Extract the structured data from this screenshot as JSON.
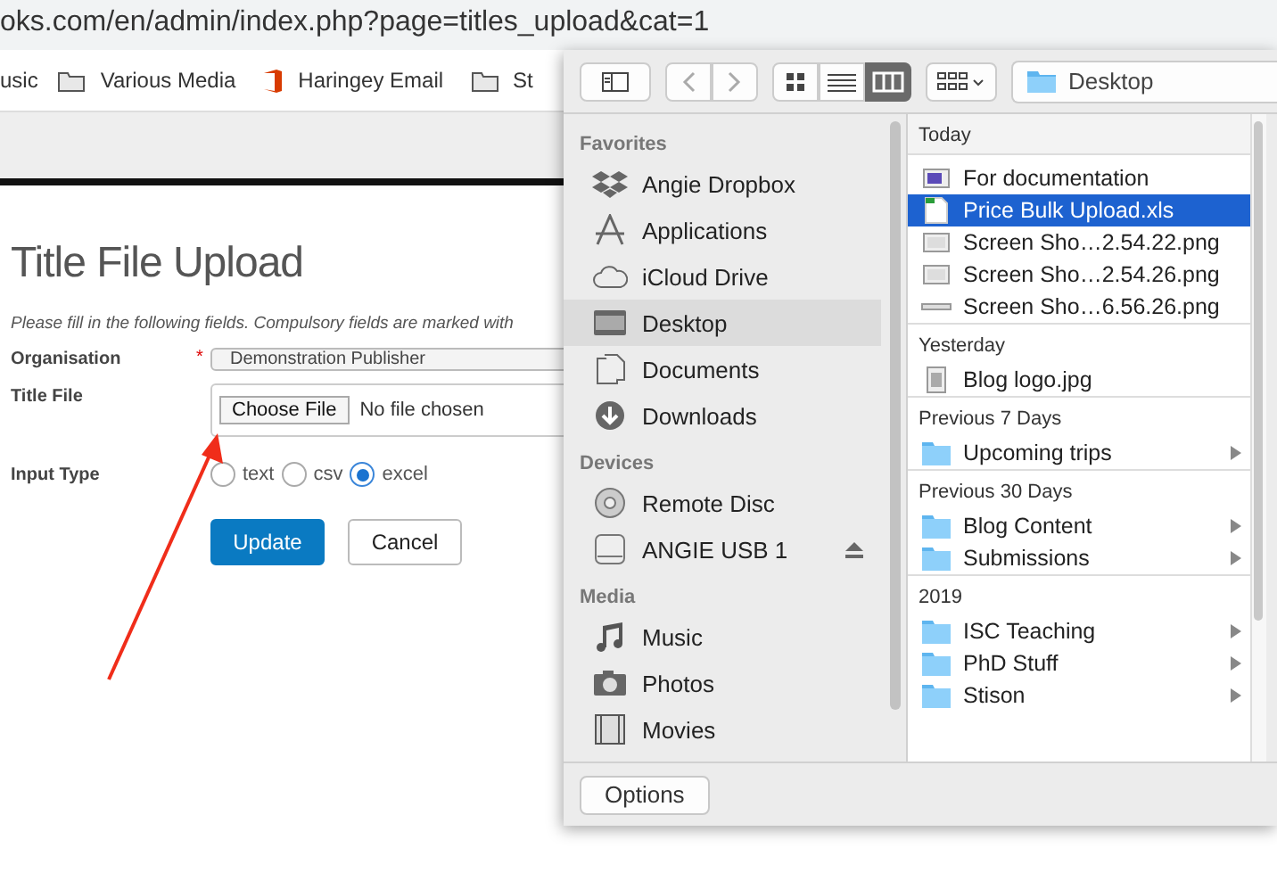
{
  "address_bar": {
    "url": "oks.com/en/admin/index.php?page=titles_upload&cat=1"
  },
  "bookmarks": [
    {
      "label": "usic",
      "kind": "text"
    },
    {
      "label": "Various Media",
      "kind": "folder"
    },
    {
      "label": "Haringey Email",
      "kind": "office"
    },
    {
      "label": "St",
      "kind": "folder"
    }
  ],
  "page": {
    "title": "Title File Upload",
    "instructions": "Please fill in the following fields. Compulsory fields are marked with",
    "organisation": {
      "label": "Organisation",
      "required": true,
      "required_mark": "*",
      "value": "Demonstration Publisher"
    },
    "title_file": {
      "label": "Title File",
      "button": "Choose File",
      "status": "No file chosen"
    },
    "input_type": {
      "label": "Input Type",
      "options": [
        {
          "label": "text",
          "selected": false
        },
        {
          "label": "csv",
          "selected": false
        },
        {
          "label": "excel",
          "selected": true
        }
      ]
    },
    "buttons": [
      {
        "label": "Update",
        "kind": "primary"
      },
      {
        "label": "Cancel",
        "kind": "default"
      }
    ]
  },
  "dialog": {
    "view_modes": [
      {
        "kind": "icons",
        "selected": false
      },
      {
        "kind": "list",
        "selected": false
      },
      {
        "kind": "columns",
        "selected": true
      }
    ],
    "location": "Desktop",
    "sidebar": [
      {
        "heading": "Favorites",
        "items": [
          {
            "label": "Angie Dropbox",
            "kind": "dropbox",
            "selected": false
          },
          {
            "label": "Applications",
            "kind": "apps",
            "selected": false
          },
          {
            "label": "iCloud Drive",
            "kind": "cloud",
            "selected": false
          },
          {
            "label": "Desktop",
            "kind": "desktop",
            "selected": true
          },
          {
            "label": "Documents",
            "kind": "docs",
            "selected": false
          },
          {
            "label": "Downloads",
            "kind": "download",
            "selected": false
          }
        ]
      },
      {
        "heading": "Devices",
        "items": [
          {
            "label": "Remote Disc",
            "kind": "disc",
            "selected": false
          },
          {
            "label": "ANGIE USB 1",
            "kind": "drive",
            "selected": false,
            "eject": true
          }
        ]
      },
      {
        "heading": "Media",
        "items": [
          {
            "label": "Music",
            "kind": "music",
            "selected": false
          },
          {
            "label": "Photos",
            "kind": "camera",
            "selected": false
          },
          {
            "label": "Movies",
            "kind": "film",
            "selected": false
          }
        ]
      }
    ],
    "groups": [
      {
        "heading": "Today",
        "items": [
          {
            "name": "For documentation",
            "kind": "screen",
            "selected": false,
            "has_children": false
          },
          {
            "name": "Price Bulk Upload.xls",
            "kind": "sheet",
            "selected": true,
            "has_children": false
          },
          {
            "name": "Screen Sho…2.54.22.png",
            "kind": "image",
            "selected": false,
            "has_children": false
          },
          {
            "name": "Screen Sho…2.54.26.png",
            "kind": "image",
            "selected": false,
            "has_children": false
          },
          {
            "name": "Screen Sho…6.56.26.png",
            "kind": "strip",
            "selected": false,
            "has_children": false
          }
        ]
      },
      {
        "heading": "Yesterday",
        "items": [
          {
            "name": "Blog logo.jpg",
            "kind": "jpg",
            "selected": false,
            "has_children": false
          }
        ]
      },
      {
        "heading": "Previous 7 Days",
        "items": [
          {
            "name": "Upcoming trips",
            "kind": "folder",
            "selected": false,
            "has_children": true
          }
        ]
      },
      {
        "heading": "Previous 30 Days",
        "items": [
          {
            "name": "Blog Content",
            "kind": "folder",
            "selected": false,
            "has_children": true
          },
          {
            "name": "Submissions",
            "kind": "folder",
            "selected": false,
            "has_children": true
          }
        ]
      },
      {
        "heading": "2019",
        "items": [
          {
            "name": "ISC Teaching",
            "kind": "folder",
            "selected": false,
            "has_children": true
          },
          {
            "name": "PhD Stuff",
            "kind": "folder",
            "selected": false,
            "has_children": true
          },
          {
            "name": "Stison",
            "kind": "folder",
            "selected": false,
            "has_children": true
          }
        ]
      }
    ],
    "buttons": [
      "Options"
    ]
  }
}
